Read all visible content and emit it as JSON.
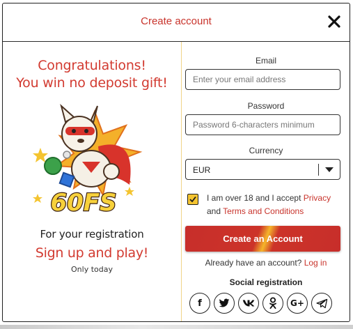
{
  "modal": {
    "title": "Create account"
  },
  "promo": {
    "title_line1": "Congratulations!",
    "title_line2": "You win no deposit gift!",
    "badge_text": "60FS",
    "subtitle": "For your registration",
    "cta": "Sign up and play!",
    "note": "Only today"
  },
  "form": {
    "email": {
      "label": "Email",
      "placeholder": "Enter your email address",
      "value": ""
    },
    "password": {
      "label": "Password",
      "placeholder": "Password 6-characters minimum",
      "value": ""
    },
    "currency": {
      "label": "Currency",
      "selected": "EUR"
    },
    "terms": {
      "checked": true,
      "prefix": "I am over 18 and I accept",
      "privacy_link": "Privacy",
      "and": "and",
      "terms_link": "Terms and Conditions"
    },
    "submit_label": "Create an Account",
    "login_prompt": "Already have an account?",
    "login_link": "Log in"
  },
  "social": {
    "title": "Social registration",
    "providers": [
      {
        "name": "facebook-icon",
        "glyph": "f"
      },
      {
        "name": "twitter-icon",
        "glyph": ""
      },
      {
        "name": "vk-icon",
        "glyph": ""
      },
      {
        "name": "odnoklassniki-icon",
        "glyph": ""
      },
      {
        "name": "google-plus-icon",
        "glyph": "G+"
      },
      {
        "name": "telegram-icon",
        "glyph": ""
      }
    ]
  },
  "colors": {
    "accent_red": "#c8332b",
    "checkbox_yellow": "#f4c430",
    "divider": "#f0d488"
  }
}
